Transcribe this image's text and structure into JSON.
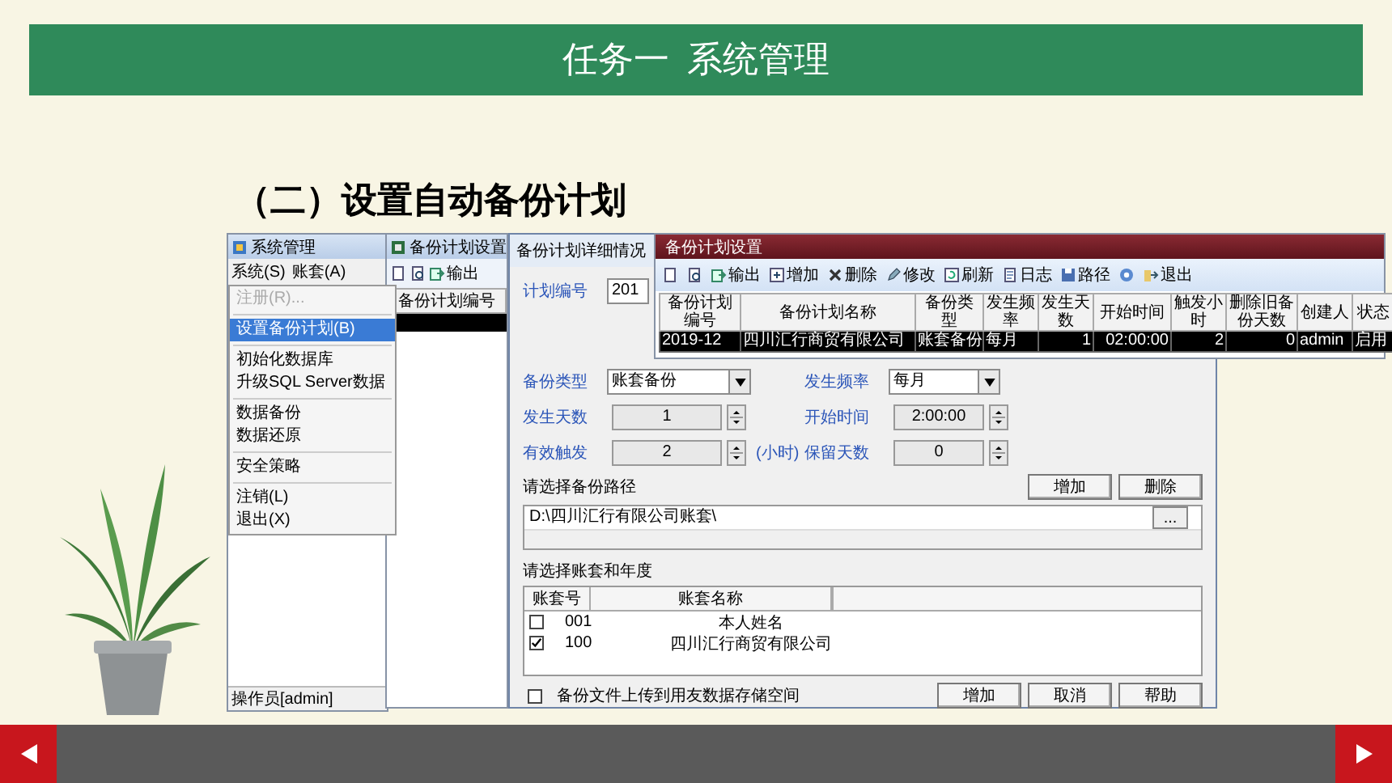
{
  "slide": {
    "title": "任务一  系统管理",
    "heading": "（二）设置自动备份计划"
  },
  "main_window": {
    "title": "系统管理",
    "menu": [
      "系统(S)",
      "账套(A)"
    ],
    "dropdown": [
      [
        {
          "label": "注册(R)...",
          "disabled": true,
          "selected": false
        }
      ],
      [
        {
          "label": "设置备份计划(B)",
          "disabled": false,
          "selected": true
        }
      ],
      [
        {
          "label": "初始化数据库",
          "disabled": false,
          "selected": false
        },
        {
          "label": "升级SQL Server数据",
          "disabled": false,
          "selected": false
        }
      ],
      [
        {
          "label": "数据备份",
          "disabled": false,
          "selected": false
        },
        {
          "label": "数据还原",
          "disabled": false,
          "selected": false
        }
      ],
      [
        {
          "label": "安全策略",
          "disabled": false,
          "selected": false
        }
      ],
      [
        {
          "label": "注销(L)",
          "disabled": false,
          "selected": false
        },
        {
          "label": "退出(X)",
          "disabled": false,
          "selected": false
        }
      ]
    ],
    "status": "操作员[admin]"
  },
  "list_window": {
    "title": "备份计划设置",
    "toolbar": [
      {
        "kind": "page"
      },
      {
        "kind": "preview"
      },
      {
        "kind": "export",
        "label": "输出"
      }
    ],
    "column": "备份计划编号",
    "rows": [
      {
        "selected": true
      }
    ]
  },
  "plan_window": {
    "title": "备份计划设置",
    "toolbar": [
      {
        "kind": "page"
      },
      {
        "kind": "preview"
      },
      {
        "kind": "export",
        "label": "输出"
      },
      {
        "kind": "add",
        "label": "增加"
      },
      {
        "kind": "delete",
        "label": "删除"
      },
      {
        "kind": "edit",
        "label": "修改"
      },
      {
        "kind": "refresh",
        "label": "刷新"
      },
      {
        "kind": "log",
        "label": "日志"
      },
      {
        "kind": "path",
        "label": "路径"
      },
      {
        "kind": "help"
      },
      {
        "kind": "exit",
        "label": "退出"
      }
    ],
    "columns": [
      "备份计划编号",
      "备份计划名称",
      "备份类型",
      "发生频率",
      "发生天数",
      "开始时间",
      "触发小时",
      "删除旧备份天数",
      "创建人",
      "状态"
    ],
    "rows": [
      {
        "selected": true,
        "cells": [
          "2019-12",
          "四川汇行商贸有限公司",
          "账套备份",
          "每月",
          "1",
          "02:00:00",
          "2",
          "0",
          "admin",
          "启用"
        ]
      }
    ]
  },
  "dialog": {
    "title": "备份计划详细情况",
    "rows": [
      [
        {
          "label": "计划编号",
          "value": "201",
          "kind": "text"
        }
      ],
      [
        {
          "label": "备份类型",
          "value": "账套备份",
          "kind": "combo"
        },
        {
          "label": "发生频率",
          "value": "每月",
          "kind": "combo"
        }
      ],
      [
        {
          "label": "发生天数",
          "value": "1",
          "kind": "spin"
        },
        {
          "label": "开始时间",
          "value": "2:00:00",
          "kind": "spin"
        }
      ],
      [
        {
          "label": "有效触发",
          "value": "2",
          "kind": "spin",
          "unit": "(小时)"
        },
        {
          "label": "保留天数",
          "value": "0",
          "kind": "spin"
        }
      ]
    ],
    "path_section": {
      "label": "请选择备份路径",
      "buttons": [
        "增加",
        "删除"
      ],
      "path": "D:\\四川汇行有限公司账套\\",
      "browse": "..."
    },
    "accounts": {
      "label": "请选择账套和年度",
      "columns": [
        "账套号",
        "账套名称"
      ],
      "rows": [
        {
          "checked": false,
          "code": "001",
          "name": "本人姓名"
        },
        {
          "checked": true,
          "code": "100",
          "name": "四川汇行商贸有限公司"
        }
      ]
    },
    "upload": {
      "checked": false,
      "label": "备份文件上传到用友数据存储空间"
    },
    "buttons": [
      "增加",
      "取消",
      "帮助"
    ]
  }
}
